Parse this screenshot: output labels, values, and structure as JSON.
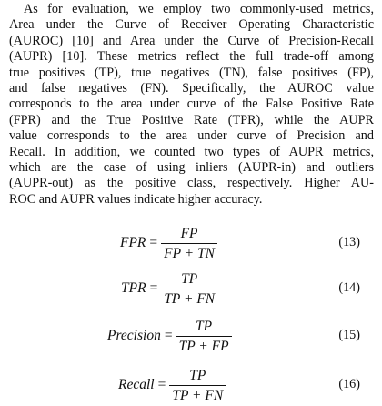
{
  "paragraph": {
    "lines": [
      "As for evaluation, we employ two commonly-used metrics,",
      "Area under the Curve of Receiver Operating Characteristic",
      "(AUROC) [10] and Area under the Curve of Precision-Recall",
      "(AUPR) [10]. These metrics reflect the full trade-off among",
      "true positives (TP), true negatives (TN), false positives (FP),",
      "and false negatives (FN). Specifically, the AUROC value",
      "corresponds to the area under curve of the False Positive Rate",
      "(FPR) and the True Positive Rate (TPR), while the AUPR",
      "value corresponds to the area under curve of Precision and",
      "Recall. In addition, we counted two types of AUPR metrics,",
      "which are the case of using inliers (AUPR-in) and outliers",
      "(AUPR-out) as the positive class, respectively. Higher AU-",
      "ROC and AUPR values indicate higher accuracy."
    ]
  },
  "equations": [
    {
      "lhs": "FPR",
      "op": "=",
      "numerator": "FP",
      "denominator": "FP + TN",
      "number": "(13)"
    },
    {
      "lhs": "TPR",
      "op": "=",
      "numerator": "TP",
      "denominator": "TP + FN",
      "number": "(14)"
    },
    {
      "lhs": "Precision",
      "op": "=",
      "numerator": "TP",
      "denominator": "TP + FP",
      "number": "(15)"
    },
    {
      "lhs": "Recall",
      "op": "=",
      "numerator": "TP",
      "denominator": "TP + FN",
      "number": "(16)"
    }
  ]
}
